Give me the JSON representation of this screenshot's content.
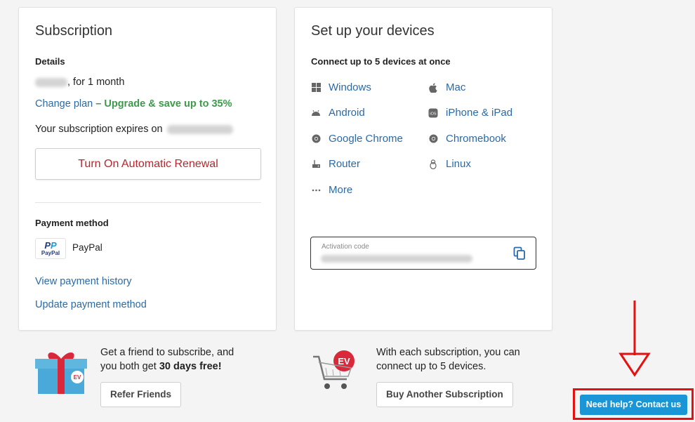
{
  "subscription": {
    "title": "Subscription",
    "details_label": "Details",
    "price_suffix": ", for 1 month",
    "change_plan": "Change plan",
    "upgrade_text": "– Upgrade & save up to 35%",
    "expires_text": "Your subscription expires on",
    "renew_button": "Turn On Automatic Renewal",
    "payment_label": "Payment method",
    "payment_badge": "PayPal",
    "payment_name": "PayPal",
    "view_history": "View payment history",
    "update_payment": "Update payment method"
  },
  "devices": {
    "title": "Set up your devices",
    "subtitle": "Connect up to 5 devices at once",
    "items": [
      {
        "label": "Windows",
        "icon": "windows-icon"
      },
      {
        "label": "Mac",
        "icon": "apple-icon"
      },
      {
        "label": "Android",
        "icon": "android-icon"
      },
      {
        "label": "iPhone & iPad",
        "icon": "ios-icon"
      },
      {
        "label": "Google Chrome",
        "icon": "chrome-icon"
      },
      {
        "label": "Chromebook",
        "icon": "chrome-icon"
      },
      {
        "label": "Router",
        "icon": "router-icon"
      },
      {
        "label": "Linux",
        "icon": "linux-icon"
      },
      {
        "label": "More",
        "icon": "more-icon"
      }
    ],
    "activation_label": "Activation code"
  },
  "promos": {
    "refer_text": "Get a friend to subscribe, and",
    "refer_text2": "you both get",
    "refer_bold": "30 days free!",
    "refer_button": "Refer Friends",
    "buy_text": "With each subscription, you can",
    "buy_text2": "connect up to 5 devices.",
    "buy_button": "Buy Another Subscription"
  },
  "help": {
    "button": "Need help? Contact us"
  },
  "colors": {
    "link": "#2a6aa8",
    "green": "#3d9a4a",
    "renew_red": "#b5272d",
    "help_blue": "#1a96d6",
    "annotation_red": "#e51010"
  }
}
